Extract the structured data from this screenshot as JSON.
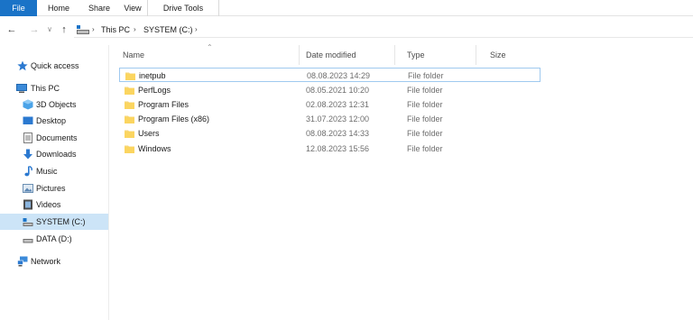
{
  "ribbon": {
    "tabs": [
      "File",
      "Home",
      "Share",
      "View",
      "Drive Tools"
    ],
    "accent": "#1a73c7"
  },
  "address": {
    "crumbs": [
      "This PC",
      "SYSTEM (C:)"
    ]
  },
  "sidebar": {
    "items": [
      {
        "label": "Quick access",
        "icon": "star-icon"
      },
      {
        "label": "This PC",
        "icon": "computer-icon"
      },
      {
        "label": "3D Objects",
        "icon": "cube-icon"
      },
      {
        "label": "Desktop",
        "icon": "desktop-icon"
      },
      {
        "label": "Documents",
        "icon": "document-icon"
      },
      {
        "label": "Downloads",
        "icon": "download-icon"
      },
      {
        "label": "Music",
        "icon": "music-icon"
      },
      {
        "label": "Pictures",
        "icon": "picture-icon"
      },
      {
        "label": "Videos",
        "icon": "video-icon"
      },
      {
        "label": "SYSTEM (C:)",
        "icon": "system-drive-icon",
        "selected": true
      },
      {
        "label": "DATA (D:)",
        "icon": "drive-icon"
      },
      {
        "label": "Network",
        "icon": "network-icon"
      }
    ]
  },
  "columns": {
    "name": "Name",
    "date": "Date modified",
    "type": "Type",
    "size": "Size"
  },
  "files": [
    {
      "name": "inetpub",
      "date": "08.08.2023 14:29",
      "type": "File folder",
      "focused": true
    },
    {
      "name": "PerfLogs",
      "date": "08.05.2021 10:20",
      "type": "File folder"
    },
    {
      "name": "Program Files",
      "date": "02.08.2023 12:31",
      "type": "File folder"
    },
    {
      "name": "Program Files (x86)",
      "date": "31.07.2023 12:00",
      "type": "File folder"
    },
    {
      "name": "Users",
      "date": "08.08.2023 14:33",
      "type": "File folder"
    },
    {
      "name": "Windows",
      "date": "12.08.2023 15:56",
      "type": "File folder"
    }
  ]
}
